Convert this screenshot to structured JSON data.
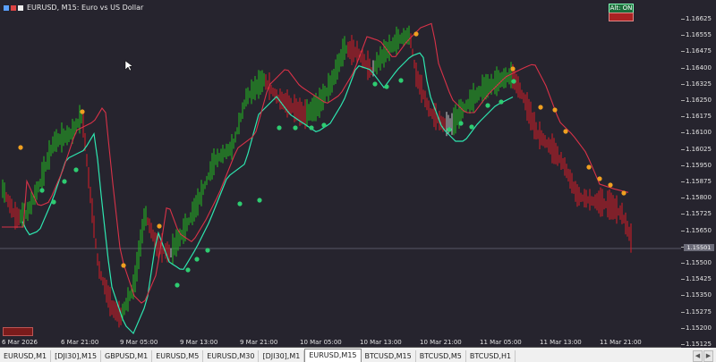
{
  "chart": {
    "title": "EURUSD, M15:  Euro vs US Dollar",
    "algo_button": "Alt: ON",
    "price_tag": "1.15501",
    "price_labels": [
      "1.16625",
      "1.16555",
      "1.16475",
      "1.16400",
      "1.16325",
      "1.16250",
      "1.16175",
      "1.16100",
      "1.16025",
      "1.15950",
      "1.15875",
      "1.15800",
      "1.15725",
      "1.15650",
      "1.15575",
      "1.15500",
      "1.15425",
      "1.15350",
      "1.15275",
      "1.15200",
      "1.15125"
    ],
    "time_labels": [
      "6 Mar 2026",
      "6 Mar 21:00",
      "9 Mar 05:00",
      "9 Mar 13:00",
      "9 Mar 21:00",
      "10 Mar 05:00",
      "10 Mar 13:00",
      "10 Mar 21:00",
      "11 Mar 05:00",
      "11 Mar 13:00",
      "11 Mar 21:00"
    ]
  },
  "tabs": [
    {
      "label": "EURUSD,M1"
    },
    {
      "label": "[DJI30],M15"
    },
    {
      "label": "GBPUSD,M1"
    },
    {
      "label": "EURUSD,M5"
    },
    {
      "label": "EURUSD,M30"
    },
    {
      "label": "[DJI30],M1"
    },
    {
      "label": "EURUSD,M15"
    },
    {
      "label": "BTCUSD,M15"
    },
    {
      "label": "BTCUSD,M5"
    },
    {
      "label": "BTCUSD,H1"
    }
  ],
  "active_tab": 6,
  "colors": {
    "bg": "#26242e",
    "bull": "#22b022",
    "bear": "#c81e28",
    "neutral": "#bcbcbc",
    "fast_ma": "#2ee6b0",
    "slow_ma": "#d83248",
    "signal_up": "#2ecc71",
    "signal_down": "#f0a020"
  }
}
